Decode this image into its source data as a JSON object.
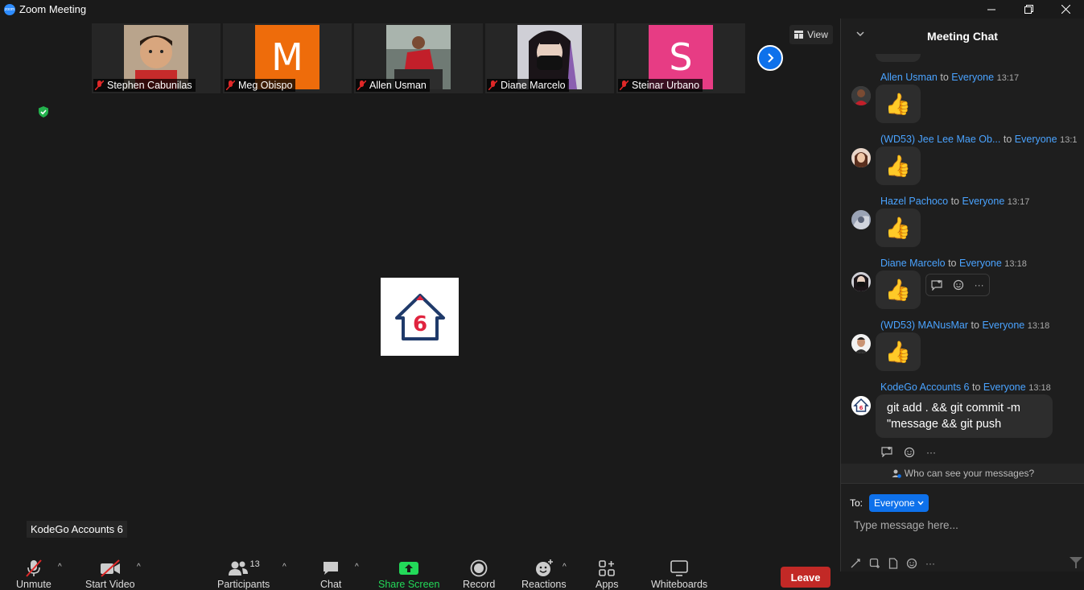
{
  "window": {
    "title": "Zoom Meeting",
    "controls": [
      "minimize",
      "restore",
      "close"
    ]
  },
  "participants_strip": [
    {
      "name": "Stephen Cabunilas",
      "kind": "photo",
      "photo": "child-photo"
    },
    {
      "name": "Meg Obispo",
      "kind": "letter",
      "letter": "M",
      "color": "#ee6c0b"
    },
    {
      "name": "Allen Usman",
      "kind": "photo",
      "photo": "outdoor-photo"
    },
    {
      "name": "Diane Marcelo",
      "kind": "photo",
      "photo": "masked-photo"
    },
    {
      "name": "Steinar Urbano",
      "kind": "letter",
      "letter": "S",
      "color": "#e73c84"
    }
  ],
  "view_button": {
    "label": "View"
  },
  "active_speaker": {
    "name_tag": "KodeGo Accounts 6",
    "logo_number": "6"
  },
  "toolbar": {
    "unmute": "Unmute",
    "start_video": "Start Video",
    "participants": "Participants",
    "participants_count": "13",
    "chat": "Chat",
    "share_screen": "Share Screen",
    "record": "Record",
    "reactions": "Reactions",
    "apps": "Apps",
    "whiteboards": "Whiteboards",
    "leave": "Leave"
  },
  "chat": {
    "title": "Meeting Chat",
    "to_word": "to",
    "messages": [
      {
        "sender": "Allen Usman",
        "to": "Everyone",
        "time": "13:17",
        "content": "👍",
        "type": "emoji"
      },
      {
        "sender": "(WD53) Jee Lee Mae Ob...",
        "to": "Everyone",
        "time": "13:1",
        "content": "👍",
        "type": "emoji"
      },
      {
        "sender": "Hazel Pachoco",
        "to": "Everyone",
        "time": "13:17",
        "content": "👍",
        "type": "emoji"
      },
      {
        "sender": "Diane Marcelo",
        "to": "Everyone",
        "time": "13:18",
        "content": "👍",
        "type": "emoji"
      },
      {
        "sender": "(WD53) MANusMar",
        "to": "Everyone",
        "time": "13:18",
        "content": "👍",
        "type": "emoji"
      },
      {
        "sender": "KodeGo Accounts 6",
        "to": "Everyone",
        "time": "13:18",
        "content": "git add . && git commit -m \"message && git push",
        "type": "text"
      }
    ],
    "who_can_see": "Who can see your messages?",
    "compose": {
      "to_label": "To:",
      "recipient": "Everyone",
      "placeholder": "Type message here..."
    }
  },
  "colors": {
    "accent": "#0e71eb",
    "link": "#4aa3ff",
    "leave": "#c22926",
    "share": "#23d959"
  }
}
